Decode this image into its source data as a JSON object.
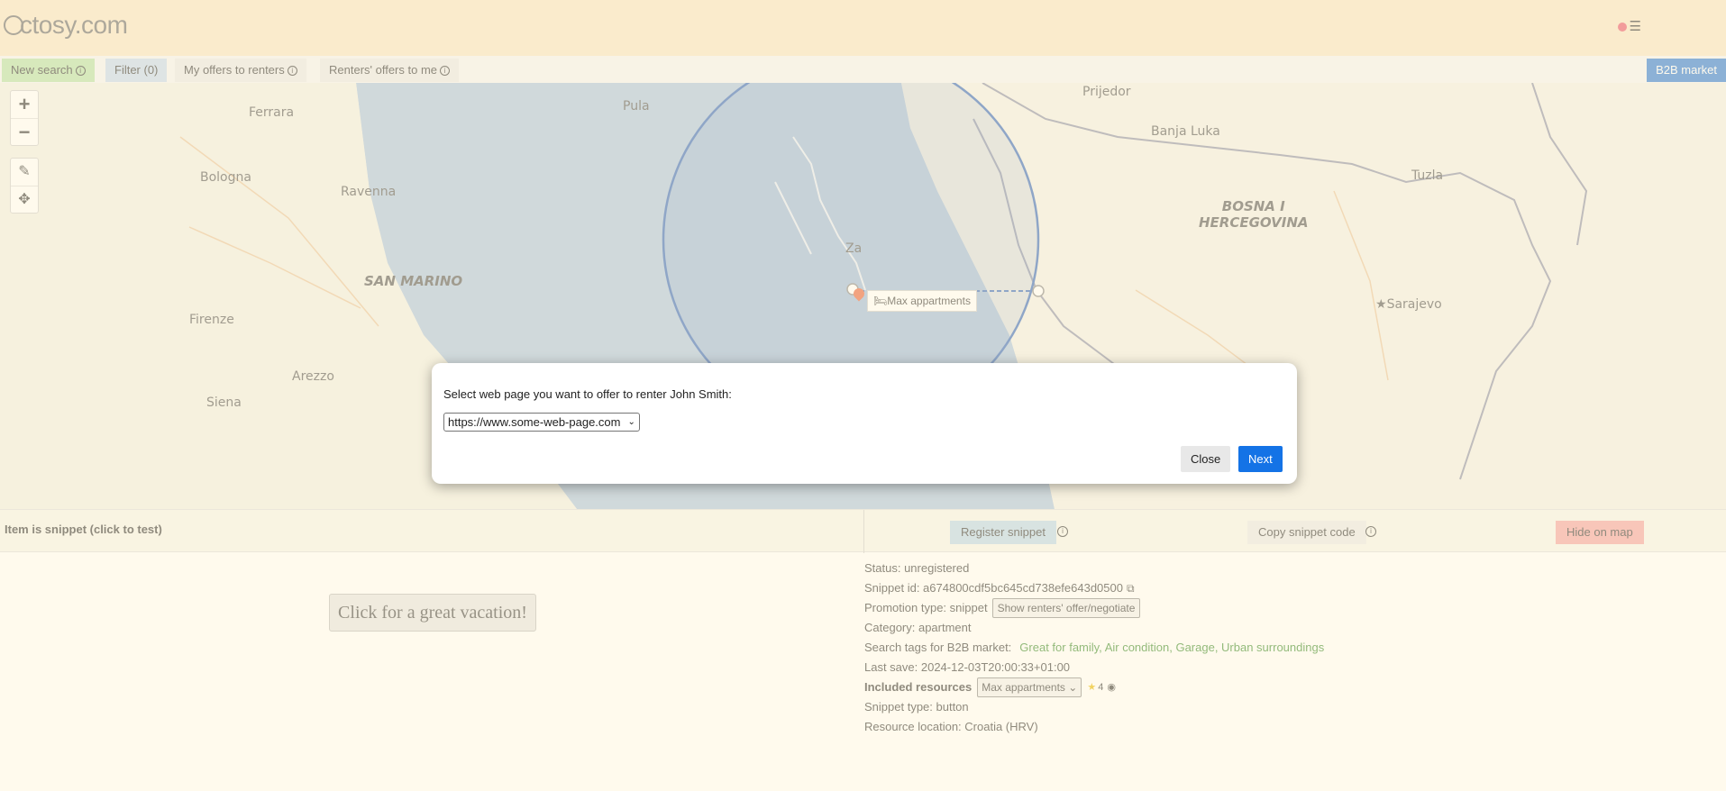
{
  "header": {
    "logo": "ctosy.com",
    "status_color": "#e7556a"
  },
  "toolbar": {
    "new_search": "New search",
    "filter": "Filter (0)",
    "my_offers": "My offers to renters",
    "renters_offers": "Renters' offers to me",
    "b2b": "B2B market"
  },
  "map": {
    "zoom_in": "+",
    "zoom_out": "−",
    "labels": {
      "prijedor": "Prijedor",
      "ferrara": "Ferrara",
      "pula": "Pula",
      "banja_luka": "Banja Luka",
      "bologna": "Bologna",
      "ravenna": "Ravenna",
      "tuzla": "Tuzla",
      "bosnia": "BOSNA I\nHERCEGOVINA",
      "san_marino": "SAN MARINO",
      "sarajevo": "Sarajevo",
      "firenze": "Firenze",
      "arezzo": "Arezzo",
      "siena": "Siena",
      "zadar": "Za"
    },
    "marker_label": "Max appartments"
  },
  "snippet_bar": {
    "title": "Item is snippet (click to test)",
    "register": "Register snippet",
    "copy_code": "Copy snippet code",
    "hide": "Hide on map"
  },
  "cta": "Click for a great vacation!",
  "details": {
    "status": "Status: unregistered",
    "snippet_id": "Snippet id: a674800cdf5bc645cd738efe643d0500",
    "promotion_label": "Promotion type: snippet",
    "promotion_btn": "Show renters' offer/negotiate",
    "category": "Category: apartment",
    "tags_label": "Search tags for B2B market:",
    "tags_value": "Great for family, Air condition, Garage, Urban surroundings",
    "last_save": "Last save: 2024-12-03T20:00:33+01:00",
    "included_label": "Included resources",
    "included_value": "Max appartments",
    "rating": "4",
    "snippet_type": "Snippet type: button",
    "location": "Resource location: Croatia (HRV)"
  },
  "modal": {
    "prompt": "Select web page you want to offer to renter John Smith:",
    "select_value": "https://www.some-web-page.com",
    "close": "Close",
    "next": "Next"
  }
}
